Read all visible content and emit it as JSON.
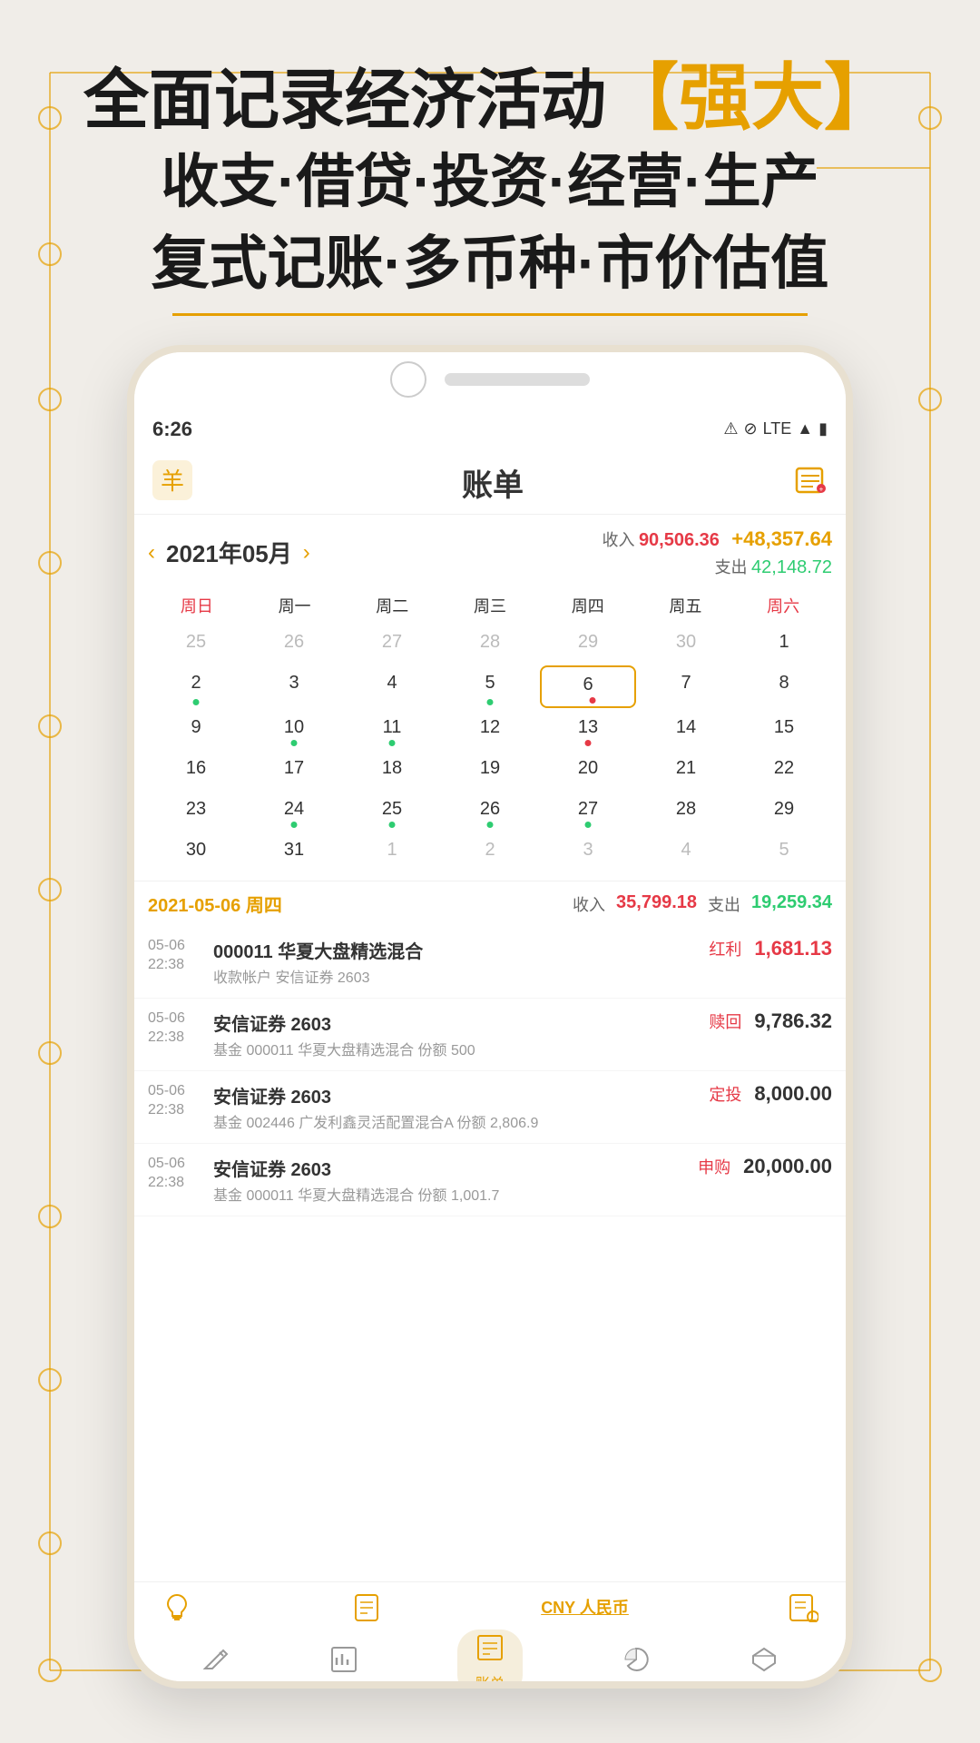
{
  "hero": {
    "line1a": "全面记录经济活动",
    "line1b_bracket_open": "【",
    "line1b_text": "强大",
    "line1b_bracket_close": "】",
    "line2": "收支·借贷·投资·经营·生产",
    "line3": "复式记账·多币种·市价估值"
  },
  "status_bar": {
    "time": "6:26",
    "signals": "LTE"
  },
  "header": {
    "title": "账单",
    "logo_alt": "app-logo"
  },
  "calendar": {
    "month": "2021年05月",
    "income_label": "收入",
    "expense_label": "支出",
    "income_value": "90,506.36",
    "expense_value": "42,148.72",
    "balance": "+48,357.64",
    "weekdays": [
      "周日",
      "周一",
      "周二",
      "周三",
      "周四",
      "周五",
      "周六"
    ],
    "days": [
      {
        "day": "25",
        "other": true
      },
      {
        "day": "26",
        "other": true
      },
      {
        "day": "27",
        "other": true
      },
      {
        "day": "28",
        "other": true
      },
      {
        "day": "29",
        "other": true
      },
      {
        "day": "30",
        "other": true
      },
      {
        "day": "1"
      },
      {
        "day": "2",
        "dot": "green"
      },
      {
        "day": "3"
      },
      {
        "day": "4"
      },
      {
        "day": "5",
        "dot": "teal"
      },
      {
        "day": "6",
        "today": true,
        "dot2": "red"
      },
      {
        "day": "7"
      },
      {
        "day": "8"
      },
      {
        "day": "9"
      },
      {
        "day": "10",
        "dot": "teal"
      },
      {
        "day": "11",
        "dot": "teal"
      },
      {
        "day": "12"
      },
      {
        "day": "13",
        "dot": "red"
      },
      {
        "day": "14"
      },
      {
        "day": "15"
      },
      {
        "day": "16"
      },
      {
        "day": "17"
      },
      {
        "day": "18"
      },
      {
        "day": "19"
      },
      {
        "day": "20"
      },
      {
        "day": "21"
      },
      {
        "day": "22"
      },
      {
        "day": "23"
      },
      {
        "day": "24",
        "dot": "teal"
      },
      {
        "day": "25",
        "dot": "teal"
      },
      {
        "day": "26",
        "dot": "teal"
      },
      {
        "day": "27",
        "dot": "teal"
      },
      {
        "day": "28"
      },
      {
        "day": "29"
      },
      {
        "day": "30"
      },
      {
        "day": "31"
      },
      {
        "day": "1",
        "other": true
      },
      {
        "day": "2",
        "other": true
      },
      {
        "day": "3",
        "other": true
      },
      {
        "day": "4",
        "other": true
      },
      {
        "day": "5",
        "other": true
      }
    ]
  },
  "day_detail": {
    "date": "2021-05-06 周四",
    "income_label": "收入",
    "income_value": "35,799.18",
    "expense_label": "支出",
    "expense_value": "19,259.34"
  },
  "transactions": [
    {
      "date": "05-06",
      "time": "22:38",
      "title": "000011 华夏大盘精选混合",
      "type": "红利",
      "sub": "收款帐户 安信证券 2603",
      "amount": "1,681.13",
      "is_income": true
    },
    {
      "date": "05-06",
      "time": "22:38",
      "title": "安信证券 2603",
      "type": "赎回",
      "sub": "基金 000011 华夏大盘精选混合 份额 500",
      "amount": "9,786.32",
      "is_income": false
    },
    {
      "date": "05-06",
      "time": "22:38",
      "title": "安信证券 2603",
      "type": "定投",
      "sub": "基金 002446 广发利鑫灵活配置混合A 份额 2,806.9",
      "amount": "8,000.00",
      "is_income": false
    },
    {
      "date": "05-06",
      "time": "22:38",
      "title": "安信证券 2603",
      "type": "申购",
      "sub": "基金 000011 华夏大盘精选混合 份额 1,001.7",
      "amount": "20,000.00",
      "is_income": false
    }
  ],
  "bottom_icons": {
    "currency": "CNY 人民币"
  },
  "bottom_nav": [
    {
      "label": "",
      "icon": "✏️",
      "active": false
    },
    {
      "label": "",
      "icon": "📊",
      "active": false
    },
    {
      "label": "账单",
      "icon": "📋",
      "active": true
    },
    {
      "label": "",
      "icon": "📈",
      "active": false
    },
    {
      "label": "",
      "icon": "💎",
      "active": false
    }
  ]
}
